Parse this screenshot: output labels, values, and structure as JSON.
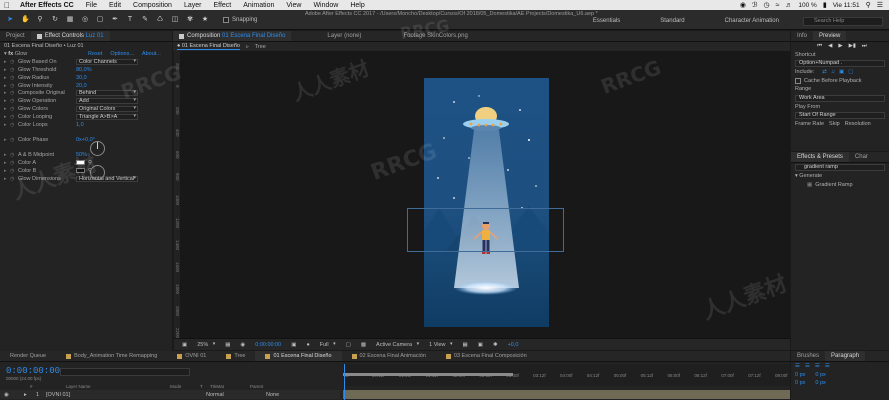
{
  "menubar": {
    "app": "After Effects CC",
    "items": [
      "File",
      "Edit",
      "Composition",
      "Layer",
      "Effect",
      "Animation",
      "View",
      "Window",
      "Help"
    ],
    "battery": "100 %",
    "clock": "Vie 11:51"
  },
  "toolbar": {
    "snapping_label": "Snapping",
    "title_path": "Adobe After Effects CC 2017 - /Users/Moncho/Desktop/Cursos/Of 2018/05_Domestika/AE Projects/Domestika_U6.aep *",
    "workspaces": [
      "Essentials",
      "Standard",
      "Character Animation"
    ],
    "search_help": "Search Help"
  },
  "left_panel": {
    "tabs": [
      "Project",
      "Effect Controls",
      "Luz 01"
    ],
    "layer_path": "01 Escena Final Diseño • Luz 01",
    "effect": {
      "name": "Glow",
      "reset": "Reset",
      "options": "Options...",
      "about": "About..."
    },
    "properties": [
      {
        "name": "Glow Based On",
        "value": "Color Channels",
        "kind": "dropdown"
      },
      {
        "name": "Glow Threshold",
        "value": "80,0%",
        "kind": "number"
      },
      {
        "name": "Glow Radius",
        "value": "30,0",
        "kind": "number"
      },
      {
        "name": "Glow Intensity",
        "value": "20,0",
        "kind": "number"
      },
      {
        "name": "Composite Original",
        "value": "Behind",
        "kind": "dropdown"
      },
      {
        "name": "Glow Operation",
        "value": "Add",
        "kind": "dropdown"
      },
      {
        "name": "Glow Colors",
        "value": "Original Colors",
        "kind": "dropdown"
      },
      {
        "name": "Color Looping",
        "value": "Triangle A>B>A",
        "kind": "dropdown"
      },
      {
        "name": "Color Loops",
        "value": "1,0",
        "kind": "number"
      },
      {
        "name": "Color Phase",
        "value": "0x+0,0°",
        "kind": "number"
      },
      {
        "name": "A & B Midpoint",
        "value": "50%",
        "kind": "number"
      },
      {
        "name": "Color A",
        "value": "#ffffff",
        "kind": "color"
      },
      {
        "name": "Color B",
        "value": "#000000",
        "kind": "color"
      },
      {
        "name": "Glow Dimensions",
        "value": "Horizontal and Vertical",
        "kind": "dropdown"
      }
    ]
  },
  "comp_panel": {
    "tabs": [
      {
        "label": "Composition",
        "comp": "01 Escena Final Diseño"
      },
      {
        "label": "Layer (none)"
      },
      {
        "label": "Footage SkinColors.png"
      }
    ],
    "subtabs": [
      "01 Escena Final Diseño",
      "Tree"
    ],
    "ruler_h": [
      "200",
      "1800",
      "1600",
      "1400",
      "1200",
      "1000",
      "800",
      "600",
      "400",
      "200",
      "0",
      "200",
      "400",
      "600",
      "800",
      "1000",
      "1200",
      "1400",
      "1600",
      "1800",
      "2000",
      "2200",
      "2400",
      "2600",
      "2800",
      "3000"
    ],
    "ruler_v": [
      "200",
      "0",
      "200",
      "400",
      "600",
      "800",
      "1000",
      "1200",
      "1400",
      "1600",
      "1800",
      "2000",
      "2200"
    ],
    "viewbar": {
      "zoom": "25%",
      "timecode": "0:00:00:00",
      "resolution": "Full",
      "camera": "Active Camera",
      "views": "1 View",
      "exposure": "+0,0"
    }
  },
  "right_panel": {
    "info_tabs": [
      "Info",
      "Preview"
    ],
    "shortcut_label": "Shortcut",
    "shortcut_value": "Option+Numpad .",
    "include_label": "Include:",
    "cache_label": "Cache Before Playback",
    "range_label": "Range",
    "range_value": "Work Area",
    "play_from_label": "Play From",
    "play_from_value": "Start Of Range",
    "frame_rate_label": "Frame Rate",
    "skip_label": "Skip",
    "resolution_label": "Resolution",
    "effects_tabs": [
      "Effects & Presets",
      "Char"
    ],
    "effects_search": "gradient ramp",
    "effects_category": "Generate",
    "effects_item": "Gradient Ramp",
    "bottom_tabs": [
      "Brushes",
      "Paragraph"
    ],
    "paragraph_values": [
      "0 px",
      "0 px",
      "0 px",
      "0 px",
      "0 px"
    ]
  },
  "timeline": {
    "tabs": [
      {
        "label": "Render Queue"
      },
      {
        "label": "Body_Animation Time Remapping",
        "color": "#c8a050"
      },
      {
        "label": "OVNI 01",
        "color": "#c8a050"
      },
      {
        "label": "Tree",
        "color": "#c8a050"
      },
      {
        "label": "01 Escena Final Diseño",
        "color": "#c8a050",
        "active": true
      },
      {
        "label": "02 Escena Final Animación",
        "color": "#c8a050"
      },
      {
        "label": "03 Escena Final Composición",
        "color": "#c8a050"
      }
    ],
    "timecode": "0:00:00:00",
    "fps": "00000 (24.00 fps)",
    "column_headers": [
      "#",
      "Layer Name",
      "Mode",
      "T",
      "TrkMat",
      "Parent"
    ],
    "layer": {
      "index": "1",
      "name": "[OVNI 01]",
      "mode": "Normal",
      "parent": "None"
    },
    "ticks": [
      "0f",
      "00:12f",
      "01:00f",
      "01:12f",
      "02:00f",
      "02:12f",
      "03:00f",
      "03:12f",
      "04:00f",
      "04:12f",
      "05:00f",
      "05:12f",
      "06:00f",
      "06:12f",
      "07:00f",
      "07:12f",
      "08:00f"
    ]
  },
  "watermarks": [
    "RRCG",
    "人人素材"
  ],
  "colors": {
    "accent": "#2d8ceb",
    "comp_bg_top": "#1e5285",
    "comp_bg_bottom": "#0f3c63"
  }
}
